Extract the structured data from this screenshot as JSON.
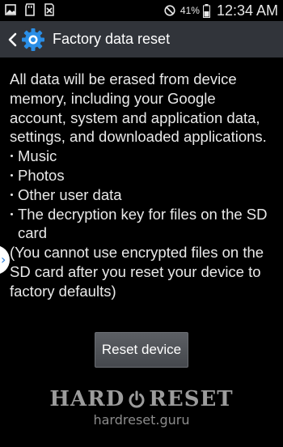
{
  "status_bar": {
    "icons": [
      "image-icon",
      "sd-card-icon",
      "no-sim-icon"
    ],
    "right_icons": [
      "do-not-disturb-icon",
      "battery-icon"
    ],
    "battery_percent": "41%",
    "time": "12:34 AM"
  },
  "header": {
    "title": "Factory data reset",
    "back_icon": "chevron-left-icon",
    "settings_icon": "gear-icon"
  },
  "content": {
    "intro": "All data will be erased from device memory, including your Google account, system and application data, settings, and downloaded applications.",
    "items": [
      "Music",
      "Photos",
      "Other user data",
      "The decryption key for files on the SD card"
    ],
    "note": "(You cannot use encrypted files on the SD card after you reset your device to factory defaults)"
  },
  "actions": {
    "reset_label": "Reset device"
  },
  "watermark": {
    "logo_left": "HARD",
    "logo_right": "RESET",
    "site": "hardreset.guru"
  },
  "colors": {
    "background": "#000000",
    "header": "#31343a",
    "gear_accent": "#2a8ee6"
  }
}
